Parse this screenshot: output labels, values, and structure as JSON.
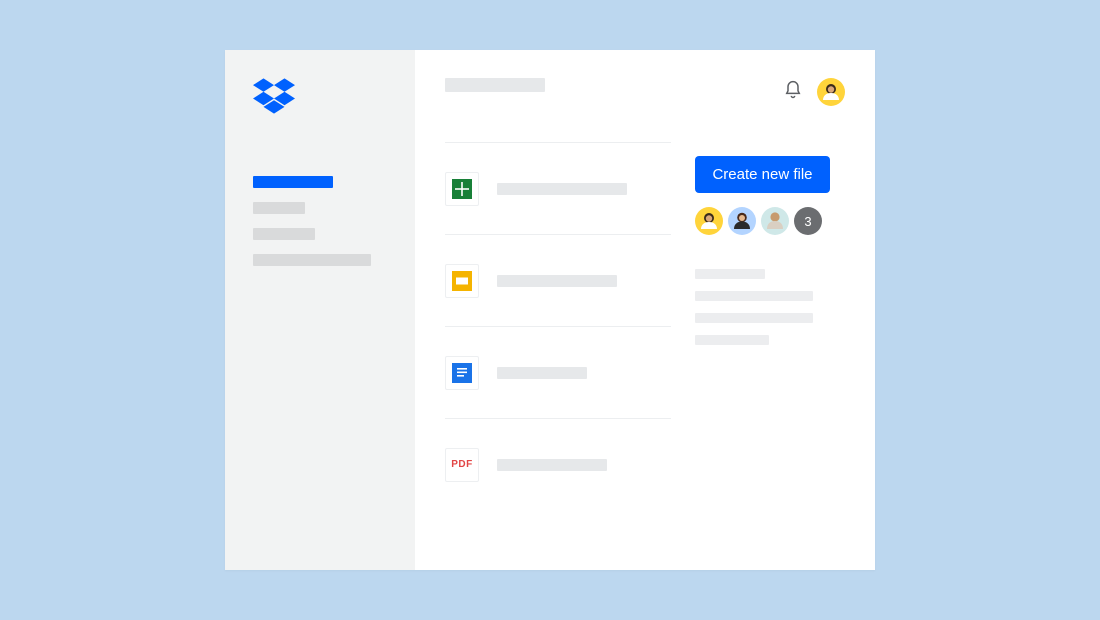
{
  "brand": {
    "name": "Dropbox"
  },
  "colors": {
    "accent": "#0061fe",
    "page_bg": "#bcd7ef",
    "sidebar_bg": "#f2f3f3",
    "placeholder": "#e6e8ea"
  },
  "sidebar": {
    "items": [
      {
        "active": true
      },
      {
        "active": false
      },
      {
        "active": false
      },
      {
        "active": false
      }
    ]
  },
  "header": {
    "title_placeholder": true
  },
  "files": [
    {
      "kind": "google-sheets"
    },
    {
      "kind": "google-slides"
    },
    {
      "kind": "google-docs"
    },
    {
      "kind": "pdf",
      "badge": "PDF"
    }
  ],
  "actions": {
    "create_label": "Create new file"
  },
  "collaborators": {
    "visible": [
      {
        "bg": "yellow"
      },
      {
        "bg": "blue"
      },
      {
        "bg": "teal"
      }
    ],
    "overflow_count": "3"
  }
}
